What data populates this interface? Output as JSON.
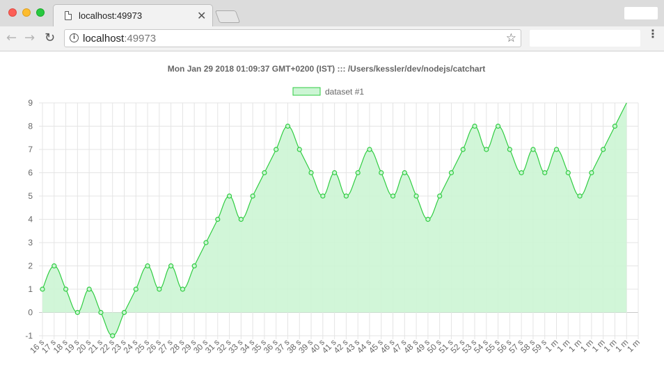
{
  "browser": {
    "tab_title": "localhost:49973",
    "url_host": "localhost",
    "url_port": ":49973",
    "back_glyph": "←",
    "forward_glyph": "→",
    "reload_glyph": "↻",
    "close_glyph": "✕",
    "star_glyph": "☆",
    "menu_glyph": "⋮",
    "info_glyph": "i",
    "icons": [
      "page-icon",
      "info-icon",
      "star-icon",
      "menu-icon"
    ]
  },
  "chart_data": {
    "type": "line",
    "title": "Mon Jan 29 2018 01:09:37 GMT+0200 (IST) ::: /Users/kessler/dev/nodejs/catchart",
    "legend_position": "top",
    "grid": true,
    "fill": true,
    "curve": "smooth",
    "line_color": "#2ecc40",
    "fill_color": "#ccf5d4",
    "ylim": [
      -1,
      9
    ],
    "yticks": [
      -1,
      0,
      1,
      2,
      3,
      4,
      5,
      6,
      7,
      8,
      9
    ],
    "categories": [
      "16 s",
      "17 s",
      "18 s",
      "19 s",
      "20 s",
      "21 s",
      "22 s",
      "23 s",
      "24 s",
      "25 s",
      "26 s",
      "27 s",
      "28 s",
      "29 s",
      "30 s",
      "31 s",
      "32 s",
      "33 s",
      "34 s",
      "35 s",
      "36 s",
      "37 s",
      "38 s",
      "39 s",
      "40 s",
      "41 s",
      "42 s",
      "43 s",
      "44 s",
      "45 s",
      "46 s",
      "47 s",
      "48 s",
      "49 s",
      "50 s",
      "51 s",
      "52 s",
      "53 s",
      "54 s",
      "55 s",
      "56 s",
      "57 s",
      "58 s",
      "59 s",
      "1 m",
      "1 m",
      "1 m",
      "1 m",
      "1 m",
      "1 m",
      "1 m",
      "1 m"
    ],
    "series": [
      {
        "name": "dataset #1",
        "values": [
          1,
          2,
          1,
          0,
          1,
          0,
          -1,
          0,
          1,
          2,
          1,
          2,
          1,
          2,
          3,
          4,
          5,
          4,
          5,
          6,
          7,
          8,
          7,
          6,
          5,
          6,
          5,
          6,
          7,
          6,
          5,
          6,
          5,
          4,
          5,
          6,
          7,
          8,
          7,
          8,
          7,
          6,
          7,
          6,
          7,
          6,
          5,
          6,
          7,
          8,
          9
        ]
      }
    ]
  }
}
